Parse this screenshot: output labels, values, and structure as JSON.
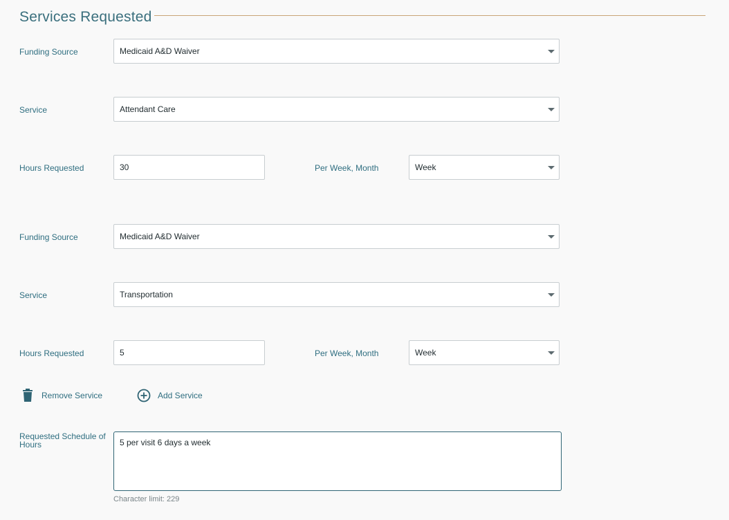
{
  "section": {
    "title": "Services Requested"
  },
  "services": [
    {
      "funding_label": "Funding Source",
      "funding_value": "Medicaid A&D Waiver",
      "service_label": "Service",
      "service_value": "Attendant Care",
      "hours_label": "Hours Requested",
      "hours_value": "30",
      "period_label": "Per Week, Month",
      "period_value": "Week"
    },
    {
      "funding_label": "Funding Source",
      "funding_value": "Medicaid A&D Waiver",
      "service_label": "Service",
      "service_value": "Transportation",
      "hours_label": "Hours Requested",
      "hours_value": "5",
      "period_label": "Per Week, Month",
      "period_value": "Week"
    }
  ],
  "actions": {
    "remove_label": "Remove Service",
    "add_label": "Add Service"
  },
  "schedule": {
    "label": "Requested Schedule of Hours",
    "value": "5 per visit 6 days a week",
    "hint": "Character limit: 229"
  },
  "icons": [
    "trash-icon",
    "plus-circle-icon",
    "chevron-down-icon"
  ],
  "colors": {
    "accent": "#2f6474",
    "rule": "#c9a477"
  }
}
